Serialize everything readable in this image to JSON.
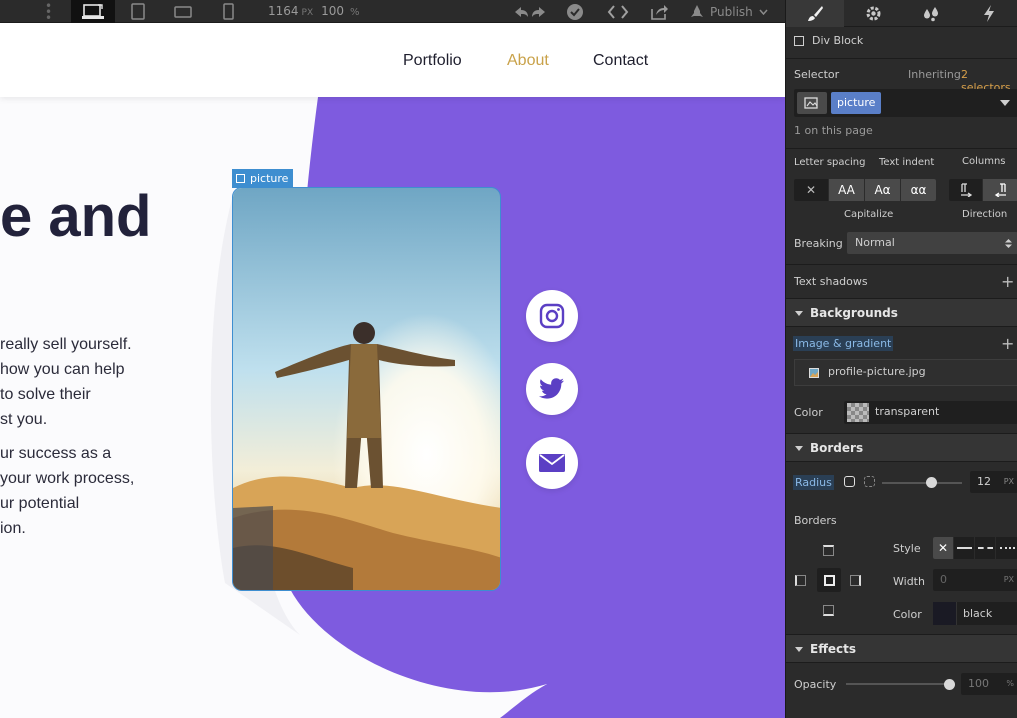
{
  "toolbar": {
    "viewport_width": "1164",
    "viewport_unit": "PX",
    "zoom": "100",
    "zoom_unit": "%",
    "publish_label": "Publish"
  },
  "site": {
    "nav": [
      "Portfolio",
      "About",
      "Contact"
    ],
    "nav_active": "About",
    "hero_heading": "e and",
    "paragraph1": [
      "really sell yourself.",
      "how you can help",
      "to solve their",
      "st you."
    ],
    "paragraph2": [
      "ur success as a",
      "your work process,",
      "ur potential",
      "ion."
    ],
    "selection_label": "picture"
  },
  "colors": {
    "purple": "#7e5bdf",
    "accent_nav": "#c9a24a",
    "selection_blue": "#3e8ed0"
  },
  "panel": {
    "element_type": "Div Block",
    "selector_label": "Selector",
    "inheriting_label": "Inheriting",
    "inheriting_count": "2 selectors",
    "selector_chip": "picture",
    "on_page": "1 on this page",
    "typography": {
      "letter_spacing": "Letter spacing",
      "text_indent": "Text indent",
      "columns": "Columns",
      "capitalize": "Capitalize",
      "direction": "Direction",
      "capitalize_options": [
        "✕",
        "AA",
        "Aα",
        "αα"
      ],
      "breaking_label": "Breaking",
      "breaking_value": "Normal",
      "text_shadows": "Text shadows"
    },
    "backgrounds": {
      "title": "Backgrounds",
      "image_gradient": "Image & gradient",
      "image_file": "profile-picture.jpg",
      "color_label": "Color",
      "color_value": "transparent"
    },
    "borders": {
      "title": "Borders",
      "radius_label": "Radius",
      "radius_value": "12",
      "radius_unit": "PX",
      "borders_label": "Borders",
      "style_label": "Style",
      "width_label": "Width",
      "width_value": "0",
      "width_unit": "PX",
      "color_label": "Color",
      "color_value": "black"
    },
    "effects": {
      "title": "Effects",
      "opacity_label": "Opacity",
      "opacity_value": "100",
      "opacity_unit": "%"
    }
  }
}
